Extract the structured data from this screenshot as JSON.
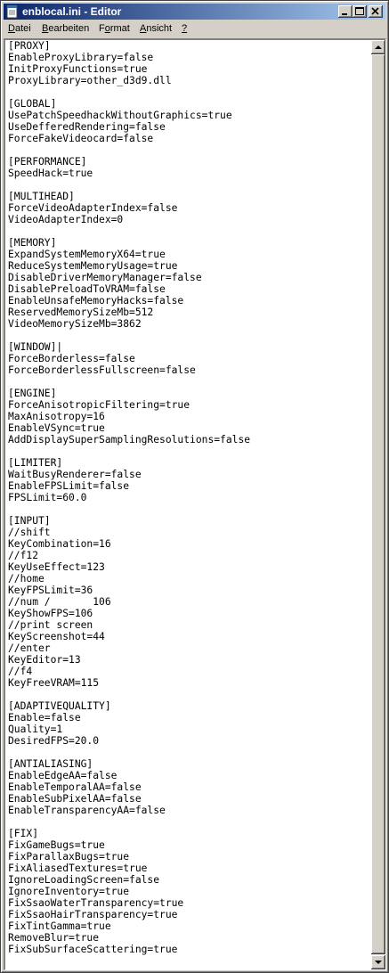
{
  "window": {
    "title": "enblocal.ini - Editor"
  },
  "menu": [
    {
      "label": "Datei",
      "underline_index": 0
    },
    {
      "label": "Bearbeiten",
      "underline_index": 0
    },
    {
      "label": "Format",
      "underline_index": 1
    },
    {
      "label": "Ansicht",
      "underline_index": 0
    },
    {
      "label": "?",
      "underline_index": 0
    }
  ],
  "editor": {
    "lines": [
      "[PROXY]",
      "EnableProxyLibrary=false",
      "InitProxyFunctions=true",
      "ProxyLibrary=other_d3d9.dll",
      "",
      "[GLOBAL]",
      "UsePatchSpeedhackWithoutGraphics=true",
      "UseDefferedRendering=false",
      "ForceFakeVideocard=false",
      "",
      "[PERFORMANCE]",
      "SpeedHack=true",
      "",
      "[MULTIHEAD]",
      "ForceVideoAdapterIndex=false",
      "VideoAdapterIndex=0",
      "",
      "[MEMORY]",
      "ExpandSystemMemoryX64=true",
      "ReduceSystemMemoryUsage=true",
      "DisableDriverMemoryManager=false",
      "DisablePreloadToVRAM=false",
      "EnableUnsafeMemoryHacks=false",
      "ReservedMemorySizeMb=512",
      "VideoMemorySizeMb=3862",
      "",
      "[WINDOW]|",
      "ForceBorderless=false",
      "ForceBorderlessFullscreen=false",
      "",
      "[ENGINE]",
      "ForceAnisotropicFiltering=true",
      "MaxAnisotropy=16",
      "EnableVSync=true",
      "AddDisplaySuperSamplingResolutions=false",
      "",
      "[LIMITER]",
      "WaitBusyRenderer=false",
      "EnableFPSLimit=false",
      "FPSLimit=60.0",
      "",
      "[INPUT]",
      "//shift",
      "KeyCombination=16",
      "//f12",
      "KeyUseEffect=123",
      "//home",
      "KeyFPSLimit=36",
      "//num /       106",
      "KeyShowFPS=106",
      "//print screen",
      "KeyScreenshot=44",
      "//enter",
      "KeyEditor=13",
      "//f4",
      "KeyFreeVRAM=115",
      "",
      "[ADAPTIVEQUALITY]",
      "Enable=false",
      "Quality=1",
      "DesiredFPS=20.0",
      "",
      "[ANTIALIASING]",
      "EnableEdgeAA=false",
      "EnableTemporalAA=false",
      "EnableSubPixelAA=false",
      "EnableTransparencyAA=false",
      "",
      "[FIX]",
      "FixGameBugs=true",
      "FixParallaxBugs=true",
      "FixAliasedTextures=true",
      "IgnoreLoadingScreen=false",
      "IgnoreInventory=true",
      "FixSsaoWaterTransparency=true",
      "FixSsaoHairTransparency=true",
      "FixTintGamma=true",
      "RemoveBlur=true",
      "FixSubSurfaceScattering=true"
    ]
  },
  "icons": {
    "app": "notepad-icon",
    "minimize": "minimize-icon",
    "maximize": "maximize-icon",
    "close": "close-icon",
    "scroll_up": "scroll-up-arrow-icon",
    "scroll_down": "scroll-down-arrow-icon"
  },
  "colors": {
    "title_gradient_start": "#0a246a",
    "title_gradient_end": "#a6caf0",
    "chrome": "#d4d0c8"
  }
}
